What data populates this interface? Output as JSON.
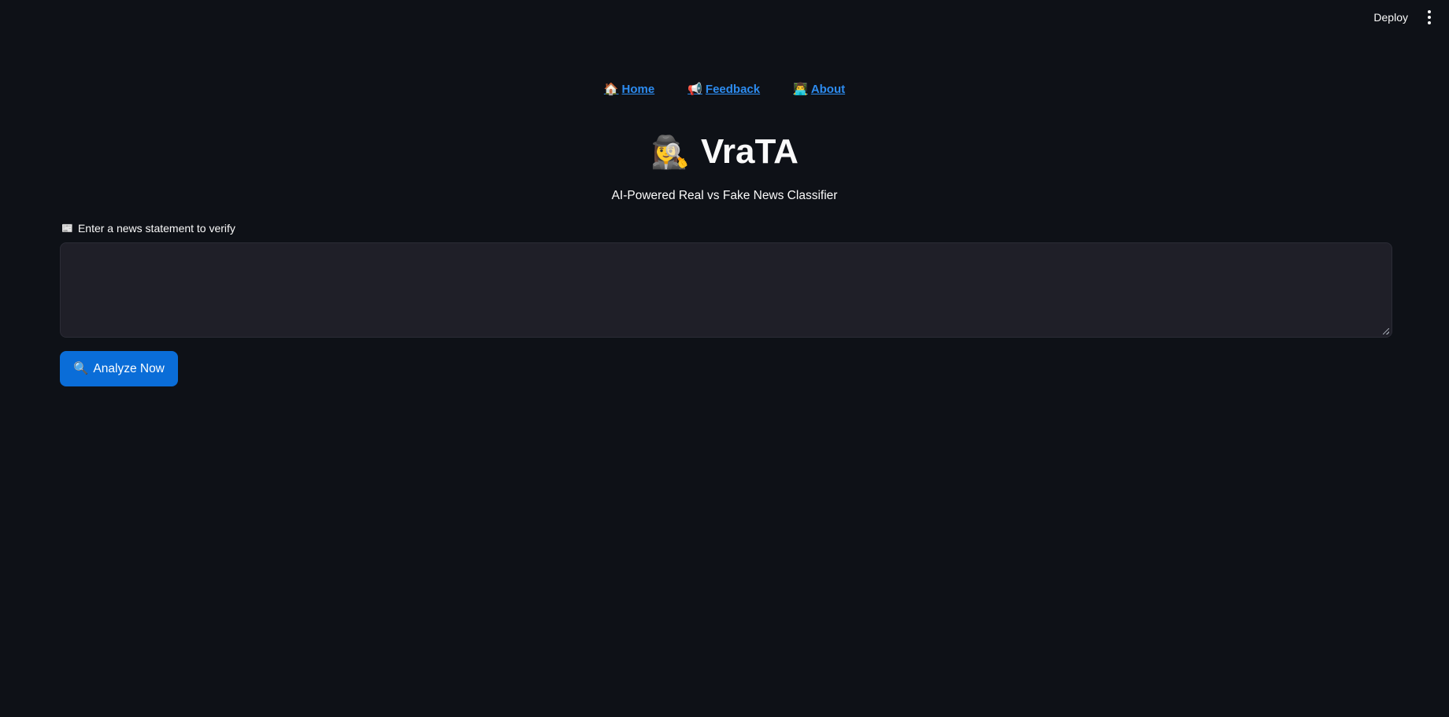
{
  "toolbar": {
    "deploy_label": "Deploy",
    "menu_icon": "kebab-menu-icon"
  },
  "nav": {
    "items": [
      {
        "emoji": "🏠",
        "label": "Home",
        "icon": "house-icon"
      },
      {
        "emoji": "📢",
        "label": "Feedback",
        "icon": "megaphone-icon"
      },
      {
        "emoji": "👨‍💻",
        "label": "About",
        "icon": "technologist-icon"
      }
    ],
    "link_color": "#2d8cf0"
  },
  "header": {
    "emoji": "🕵️‍♀️",
    "icon": "detective-icon",
    "title": "VraTA",
    "subtitle": "AI-Powered Real vs Fake News Classifier"
  },
  "form": {
    "label_emoji": "📰",
    "label_icon": "newspaper-icon",
    "label": "Enter a news statement to verify",
    "input_value": "",
    "button_emoji": "🔍",
    "button_icon": "magnifier-icon",
    "button_label": "Analyze Now"
  },
  "colors": {
    "background": "#0e1117",
    "input_background": "#1f1f28",
    "primary_button": "#0a6dd8"
  }
}
